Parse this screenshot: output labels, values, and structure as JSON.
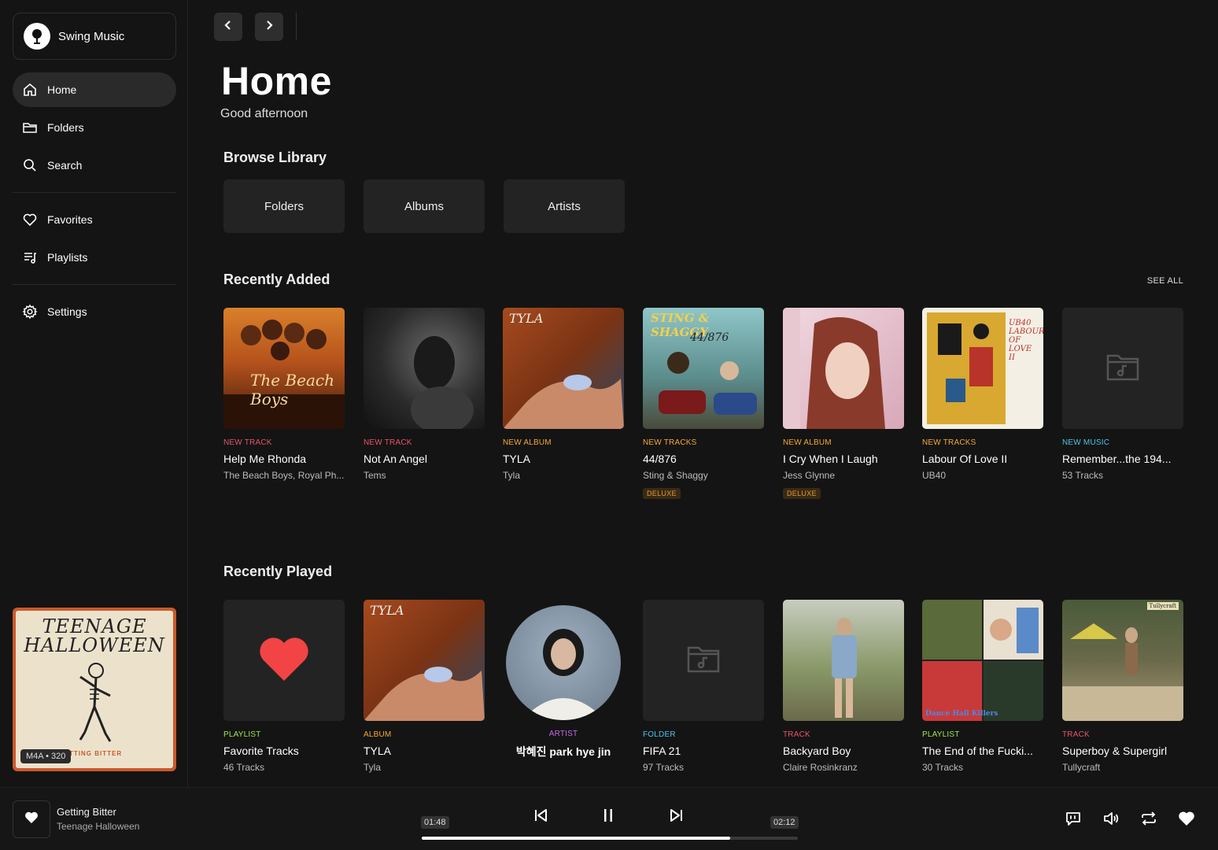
{
  "app": {
    "name": "Swing Music"
  },
  "sidebar": {
    "items": [
      {
        "label": "Home",
        "icon": "home-icon",
        "active": true
      },
      {
        "label": "Folders",
        "icon": "folder-icon"
      },
      {
        "label": "Search",
        "icon": "search-icon"
      },
      {
        "label": "Favorites",
        "icon": "heart-icon"
      },
      {
        "label": "Playlists",
        "icon": "playlist-icon"
      },
      {
        "label": "Settings",
        "icon": "gear-icon"
      }
    ],
    "now_playing_art": {
      "title": "TEENAGE HALLOWEEN",
      "strip": "TTING BITTER",
      "badge": "M4A • 320"
    }
  },
  "header": {
    "title": "Home",
    "greeting": "Good afternoon"
  },
  "browse": {
    "title": "Browse Library",
    "cards": [
      "Folders",
      "Albums",
      "Artists"
    ]
  },
  "recently_added": {
    "title": "Recently Added",
    "see_all": "SEE ALL",
    "items": [
      {
        "type": "NEW TRACK",
        "title": "Help Me Rhonda",
        "sub": "The Beach Boys, Royal Ph...",
        "art_text": "The Beach Boys"
      },
      {
        "type": "NEW TRACK",
        "title": "Not An Angel",
        "sub": "Tems"
      },
      {
        "type": "NEW ALBUM",
        "title": "TYLA",
        "sub": "Tyla",
        "art_text": "TYLA"
      },
      {
        "type": "NEW TRACKS",
        "title": "44/876",
        "sub": "Sting & Shaggy",
        "tag": "DELUXE",
        "art_text": "STING & SHAGGY",
        "art_text2": "44/876"
      },
      {
        "type": "NEW ALBUM",
        "title": "I Cry When I Laugh",
        "sub": "Jess Glynne",
        "tag": "DELUXE"
      },
      {
        "type": "NEW TRACKS",
        "title": "Labour Of Love II",
        "sub": "UB40",
        "art_text": "UB40 LABOUR OF LOVE II"
      },
      {
        "type": "NEW MUSIC",
        "title": "Remember...the 194...",
        "sub": "53 Tracks"
      }
    ]
  },
  "recently_played": {
    "title": "Recently Played",
    "items": [
      {
        "type": "PLAYLIST",
        "title": "Favorite Tracks",
        "sub": "46 Tracks"
      },
      {
        "type": "ALBUM",
        "title": "TYLA",
        "sub": "Tyla",
        "art_text": "TYLA"
      },
      {
        "type": "ARTIST",
        "title": "박혜진 park hye jin"
      },
      {
        "type": "FOLDER",
        "title": "FIFA 21",
        "sub": "97 Tracks"
      },
      {
        "type": "TRACK",
        "title": "Backyard Boy",
        "sub": "Claire Rosinkranz"
      },
      {
        "type": "PLAYLIST",
        "title": "The End of the Fucki...",
        "sub": "30 Tracks",
        "art_text": "Dance Hall Killers"
      },
      {
        "type": "TRACK",
        "title": "Superboy & Supergirl",
        "sub": "Tullycraft",
        "art_text": "Tullycraft"
      }
    ]
  },
  "player": {
    "title": "Getting Bitter",
    "artist": "Teenage Halloween",
    "elapsed": "01:48",
    "duration": "02:12",
    "progress": 0.82
  }
}
